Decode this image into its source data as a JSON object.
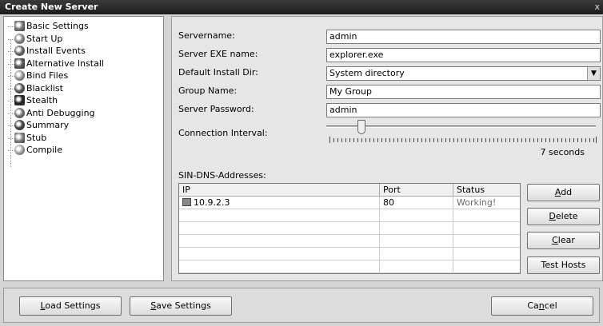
{
  "window": {
    "title": "Create New Server",
    "close": "x"
  },
  "tree": {
    "items": [
      {
        "label": "Basic Settings",
        "icon": "settings-icon",
        "color": "#7a7a7a"
      },
      {
        "label": "Start Up",
        "icon": "startup-icon",
        "color": "#8a8a8a"
      },
      {
        "label": "Install Events",
        "icon": "install-icon",
        "color": "#6a6a6a"
      },
      {
        "label": "Alternative Install",
        "icon": "alt-install-icon",
        "color": "#5a5a5a"
      },
      {
        "label": "Bind Files",
        "icon": "bind-icon",
        "color": "#9a9a9a"
      },
      {
        "label": "Blacklist",
        "icon": "blacklist-icon",
        "color": "#555555"
      },
      {
        "label": "Stealth",
        "icon": "stealth-icon",
        "color": "#222222"
      },
      {
        "label": "Anti Debugging",
        "icon": "anti-debug-icon",
        "color": "#777777"
      },
      {
        "label": "Summary",
        "icon": "summary-icon",
        "color": "#444444"
      },
      {
        "label": "Stub",
        "icon": "stub-icon",
        "color": "#888888"
      },
      {
        "label": "Compile",
        "icon": "compile-icon",
        "color": "#aaaaaa"
      }
    ]
  },
  "form": {
    "servername": {
      "label": "Servername:",
      "value": "admin"
    },
    "exe_name": {
      "label": "Server EXE name:",
      "value": "explorer.exe"
    },
    "install_dir": {
      "label": "Default Install Dir:",
      "value": "System directory"
    },
    "group_name": {
      "label": "Group Name:",
      "value": "My Group"
    },
    "password": {
      "label": "Server Password:",
      "value": "admin"
    },
    "interval": {
      "label": "Connection Interval:",
      "value_text": "7 seconds",
      "level": 0.12
    }
  },
  "dns": {
    "label": "SIN-DNS-Addresses:",
    "columns": [
      "IP",
      "Port",
      "Status"
    ],
    "rows": [
      {
        "ip": "10.9.2.3",
        "port": "80",
        "status": "Working!"
      }
    ],
    "status_color": "#6a6a6a",
    "buttons": {
      "add": {
        "u": "A",
        "rest": "dd"
      },
      "delete": {
        "u": "D",
        "rest": "elete"
      },
      "clear": {
        "u": "C",
        "rest": "lear"
      },
      "test": "Test Hosts"
    }
  },
  "footer": {
    "load": {
      "u": "L",
      "rest": "oad Settings"
    },
    "save": {
      "u": "S",
      "rest": "ave Settings"
    },
    "cancel": {
      "pre": "Ca",
      "u": "n",
      "rest": "cel"
    }
  }
}
